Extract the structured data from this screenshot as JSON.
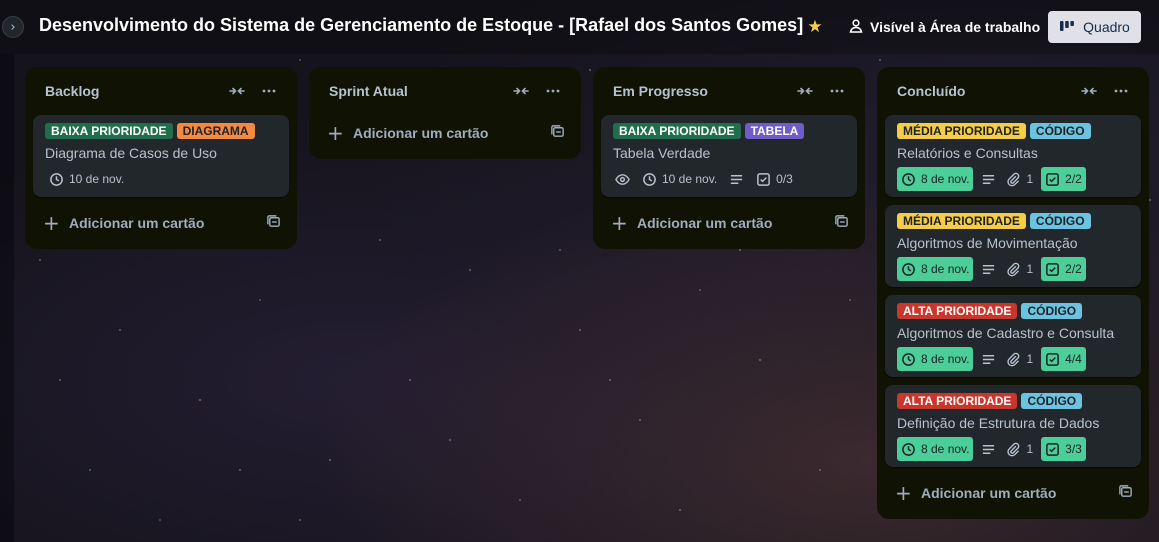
{
  "board": {
    "title": "Desenvolvimento do Sistema de Gerenciamento de Estoque - [Rafael dos Santos Gomes]",
    "visibility_label": "Visível à Área de trabalho",
    "view_label": "Quadro"
  },
  "colors": {
    "label_green": "#216e4e",
    "label_orange": "#f38a3f",
    "label_purple": "#6e5dc6",
    "label_yellow": "#f5cd47",
    "label_blue": "#6cc3e0",
    "label_red": "#c9372c",
    "badge_done": "#4bce97",
    "list_bg": "#101204",
    "card_bg": "#22272b"
  },
  "lists": [
    {
      "title": "Backlog",
      "add_label": "Adicionar um cartão",
      "cards": [
        {
          "labels": [
            {
              "text": "BAIXA PRIORIDADE",
              "color": "#216e4e",
              "fg": "#ffffff"
            },
            {
              "text": "DIAGRAMA",
              "color": "#f38a3f",
              "fg": "#1d2125"
            }
          ],
          "title": "Diagrama de Casos de Uso",
          "due": "10 de nov."
        }
      ]
    },
    {
      "title": "Sprint Atual",
      "add_label": "Adicionar um cartão",
      "cards": []
    },
    {
      "title": "Em Progresso",
      "add_label": "Adicionar um cartão",
      "cards": [
        {
          "labels": [
            {
              "text": "BAIXA PRIORIDADE",
              "color": "#216e4e",
              "fg": "#ffffff"
            },
            {
              "text": "TABELA",
              "color": "#6e5dc6",
              "fg": "#ffffff"
            }
          ],
          "title": "Tabela Verdade",
          "due": "10 de nov.",
          "checklist": "0/3"
        }
      ]
    },
    {
      "title": "Concluído",
      "add_label": "Adicionar um cartão",
      "cards": [
        {
          "labels": [
            {
              "text": "MÉDIA PRIORIDADE",
              "color": "#f5cd47",
              "fg": "#1d2125"
            },
            {
              "text": "CÓDIGO",
              "color": "#6cc3e0",
              "fg": "#1d2125"
            }
          ],
          "title": "Relatórios e Consultas",
          "due": "8 de nov.",
          "attachments": "1",
          "checklist": "2/2"
        },
        {
          "labels": [
            {
              "text": "MÉDIA PRIORIDADE",
              "color": "#f5cd47",
              "fg": "#1d2125"
            },
            {
              "text": "CÓDIGO",
              "color": "#6cc3e0",
              "fg": "#1d2125"
            }
          ],
          "title": "Algoritmos de Movimentação",
          "due": "8 de nov.",
          "attachments": "1",
          "checklist": "2/2"
        },
        {
          "labels": [
            {
              "text": "ALTA PRIORIDADE",
              "color": "#c9372c",
              "fg": "#ffffff"
            },
            {
              "text": "CÓDIGO",
              "color": "#6cc3e0",
              "fg": "#1d2125"
            }
          ],
          "title": "Algoritmos de Cadastro e Consulta",
          "due": "8 de nov.",
          "attachments": "1",
          "checklist": "4/4"
        },
        {
          "labels": [
            {
              "text": "ALTA PRIORIDADE",
              "color": "#c9372c",
              "fg": "#ffffff"
            },
            {
              "text": "CÓDIGO",
              "color": "#6cc3e0",
              "fg": "#1d2125"
            }
          ],
          "title": "Definição de Estrutura de Dados",
          "due": "8 de nov.",
          "attachments": "1",
          "checklist": "3/3"
        }
      ]
    }
  ]
}
